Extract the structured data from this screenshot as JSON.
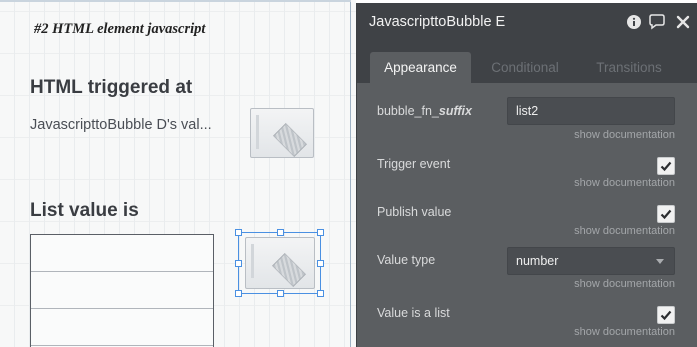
{
  "canvas": {
    "heading_element": "#2 HTML element javascript",
    "html_triggered_heading": "HTML triggered at",
    "value_text": "JavascripttoBubble D's val...",
    "list_value_heading": "List value is"
  },
  "editor": {
    "title": "JavascripttoBubble E",
    "header_icons": [
      "info-icon",
      "comment-icon",
      "close-icon"
    ],
    "tabs": [
      {
        "label": "Appearance",
        "active": true
      },
      {
        "label": "Conditional",
        "active": false
      },
      {
        "label": "Transitions",
        "active": false
      }
    ],
    "fields": {
      "suffix": {
        "label_prefix": "bubble_fn_",
        "label_suffix": "suffix",
        "value": "list2",
        "doc": "show documentation"
      },
      "trigger_event": {
        "label": "Trigger event",
        "checked": true,
        "doc": "show documentation"
      },
      "publish_value": {
        "label": "Publish value",
        "checked": true,
        "doc": "show documentation"
      },
      "value_type": {
        "label": "Value type",
        "value": "number",
        "doc": "show documentation"
      },
      "value_is_list": {
        "label": "Value is a list",
        "checked": true,
        "doc": "show documentation"
      }
    }
  },
  "colors": {
    "panel_bg": "#5b5e61",
    "header_bg": "#3f4246",
    "selection": "#4a90e2"
  }
}
